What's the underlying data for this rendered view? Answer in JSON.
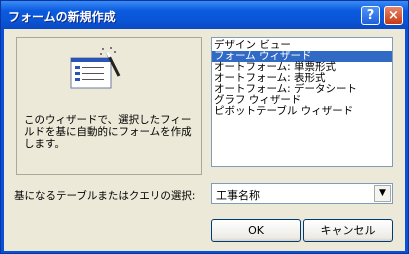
{
  "window": {
    "title": "フォームの新規作成",
    "help_label": "?",
    "close_label": "×"
  },
  "preview": {
    "icon": "form-wizard-icon",
    "description": "このウィザードで、選択したフィールドを基に自動的にフォームを作成します。"
  },
  "form_types": {
    "items": [
      {
        "label": "デザイン ビュー",
        "selected": false
      },
      {
        "label": "フォーム ウィザード",
        "selected": true
      },
      {
        "label": "オートフォーム: 単票形式",
        "selected": false
      },
      {
        "label": "オートフォーム: 表形式",
        "selected": false
      },
      {
        "label": "オートフォーム: データシート",
        "selected": false
      },
      {
        "label": "グラフ ウィザード",
        "selected": false
      },
      {
        "label": "ピボットテーブル ウィザード",
        "selected": false
      }
    ]
  },
  "source": {
    "label": "基になるテーブルまたはクエリの選択:",
    "value": "工事名称",
    "dropdown_icon": "chevron-down-icon"
  },
  "buttons": {
    "ok": "OK",
    "cancel": "キャンセル"
  }
}
